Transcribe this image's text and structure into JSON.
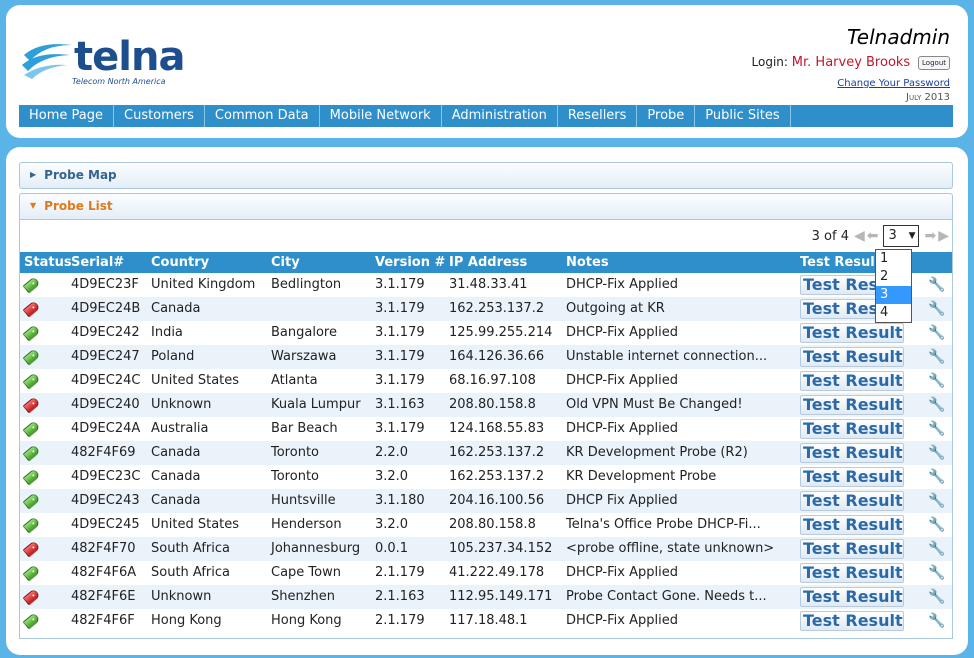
{
  "header": {
    "logo_text": "telna",
    "logo_subtitle": "Telecom North America",
    "app_name": "Telnadmin",
    "login_label": "Login:",
    "user_name": "Mr. Harvey Brooks",
    "logout_label": "Logout",
    "change_password": "Change Your Password",
    "date": "July 2013"
  },
  "nav": [
    "Home Page",
    "Customers",
    "Common Data",
    "Mobile Network",
    "Administration",
    "Resellers",
    "Probe",
    "Public Sites"
  ],
  "sections": {
    "probe_map": "Probe Map",
    "probe_list": "Probe List"
  },
  "pager": {
    "text": "3 of 4",
    "selected": "3",
    "options": [
      "1",
      "2",
      "3",
      "4"
    ]
  },
  "columns": {
    "status": "Status",
    "serial": "Serial#",
    "country": "Country",
    "city": "City",
    "version": "Version #",
    "ip": "IP Address",
    "notes": "Notes",
    "test": "Test Results"
  },
  "test_button_label": "Test Results",
  "colors": {
    "accent": "#2e8fca",
    "status_ok": "#3c9c28",
    "status_bad": "#c01818",
    "login_name": "#c4162a"
  },
  "rows": [
    {
      "status": "ok",
      "serial": "4D9EC23F",
      "country": "United Kingdom",
      "city": "Bedlington",
      "version": "3.1.179",
      "ip": "31.48.33.41",
      "notes": "DHCP-Fix Applied"
    },
    {
      "status": "bad",
      "serial": "4D9EC24B",
      "country": "Canada",
      "city": "",
      "version": "3.1.179",
      "ip": "162.253.137.2",
      "notes": "Outgoing at KR"
    },
    {
      "status": "ok",
      "serial": "4D9EC242",
      "country": "India",
      "city": "Bangalore",
      "version": "3.1.179",
      "ip": "125.99.255.214",
      "notes": "DHCP-Fix Applied"
    },
    {
      "status": "ok",
      "serial": "4D9EC247",
      "country": "Poland",
      "city": "Warszawa",
      "version": "3.1.179",
      "ip": "164.126.36.66",
      "notes": "Unstable internet connection..."
    },
    {
      "status": "ok",
      "serial": "4D9EC24C",
      "country": "United States",
      "city": "Atlanta",
      "version": "3.1.179",
      "ip": "68.16.97.108",
      "notes": "DHCP-Fix Applied"
    },
    {
      "status": "bad",
      "serial": "4D9EC240",
      "country": "Unknown",
      "city": "Kuala Lumpur",
      "version": "3.1.163",
      "ip": "208.80.158.8",
      "notes": "Old VPN Must Be Changed!"
    },
    {
      "status": "ok",
      "serial": "4D9EC24A",
      "country": "Australia",
      "city": "Bar Beach",
      "version": "3.1.179",
      "ip": "124.168.55.83",
      "notes": "DHCP-Fix Applied"
    },
    {
      "status": "ok",
      "serial": "482F4F69",
      "country": "Canada",
      "city": "Toronto",
      "version": "2.2.0",
      "ip": "162.253.137.2",
      "notes": "KR Development Probe (R2)"
    },
    {
      "status": "ok",
      "serial": "4D9EC23C",
      "country": "Canada",
      "city": "Toronto",
      "version": "3.2.0",
      "ip": "162.253.137.2",
      "notes": "KR Development Probe"
    },
    {
      "status": "ok",
      "serial": "4D9EC243",
      "country": "Canada",
      "city": "Huntsville",
      "version": "3.1.180",
      "ip": "204.16.100.56",
      "notes": "DHCP Fix Applied"
    },
    {
      "status": "ok",
      "serial": "4D9EC245",
      "country": "United States",
      "city": "Henderson",
      "version": "3.2.0",
      "ip": "208.80.158.8",
      "notes": "Telna's Office Probe DHCP-Fi..."
    },
    {
      "status": "bad",
      "serial": "482F4F70",
      "country": "South Africa",
      "city": "Johannesburg",
      "version": "0.0.1",
      "ip": "105.237.34.152",
      "notes": "<probe offline, state unknown>"
    },
    {
      "status": "ok",
      "serial": "482F4F6A",
      "country": "South Africa",
      "city": "Cape Town",
      "version": "2.1.179",
      "ip": "41.222.49.178",
      "notes": "DHCP-Fix Applied"
    },
    {
      "status": "bad",
      "serial": "482F4F6E",
      "country": "Unknown",
      "city": "Shenzhen",
      "version": "2.1.163",
      "ip": "112.95.149.171",
      "notes": "Probe Contact Gone. Needs t..."
    },
    {
      "status": "ok",
      "serial": "482F4F6F",
      "country": "Hong Kong",
      "city": "Hong Kong",
      "version": "2.1.179",
      "ip": "117.18.48.1",
      "notes": "DHCP-Fix Applied"
    }
  ]
}
